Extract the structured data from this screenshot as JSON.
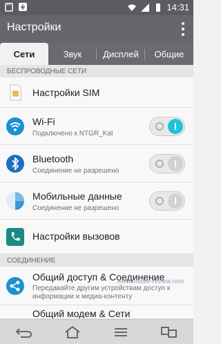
{
  "status_bar": {
    "time": "14:31"
  },
  "action_bar": {
    "title": "Настройки"
  },
  "tabs": [
    {
      "label": "Сети",
      "active": true
    },
    {
      "label": "Звук",
      "active": false
    },
    {
      "label": "Дисплей",
      "active": false
    },
    {
      "label": "Общие",
      "active": false
    }
  ],
  "sections": {
    "wireless": "БЕСПРОВОДНЫЕ СЕТИ",
    "connection": "СОЕДИНЕНИЕ"
  },
  "items": [
    {
      "title": "Настройки SIM",
      "subtitle": "",
      "icon": "sim-card-icon"
    },
    {
      "title": "Wi-Fi",
      "subtitle": "Подключено к NTGR_Kat",
      "icon": "wifi-icon",
      "toggle": "on"
    },
    {
      "title": "Bluetooth",
      "subtitle": "Соединение не разрешено",
      "icon": "bluetooth-icon",
      "toggle": "off"
    },
    {
      "title": "Мобильные данные",
      "subtitle": "Соединение не разрешено",
      "icon": "mobile-data-icon",
      "toggle": "off"
    },
    {
      "title": "Настройки вызовов",
      "subtitle": "",
      "icon": "phone-icon"
    },
    {
      "title": "Общий доступ & Соединение",
      "subtitle": "Передавайте другим устройствам доступ к информации и медиа-контенту",
      "icon": "share-icon"
    },
    {
      "title": "Общий модем & Сети",
      "subtitle": "",
      "icon": "tethering-icon"
    }
  ],
  "watermark": "www.mobile-review.com",
  "colors": {
    "accent": "#1cc4d6",
    "actionbar": "#66676b",
    "statusbar": "#5a5c60"
  }
}
